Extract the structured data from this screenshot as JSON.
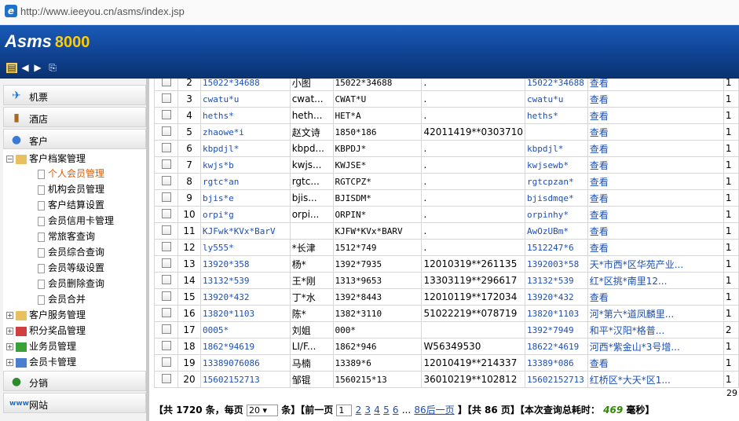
{
  "browser": {
    "url": "http://www.ieeyou.cn/asms/index.jsp"
  },
  "app": {
    "logo_text": "Asms",
    "logo_number": "8000"
  },
  "nav": {
    "ticket": "机票",
    "hotel": "酒店",
    "customer": "客户",
    "distribution": "分销",
    "website": "网站"
  },
  "tree": {
    "archive": "客户档案管理",
    "items": [
      "个人会员管理",
      "机构会员管理",
      "客户结算设置",
      "会员信用卡管理",
      "常旅客查询",
      "会员综合查询",
      "会员等级设置",
      "会员删除查询",
      "会员合并"
    ],
    "service": "客户服务管理",
    "points": "积分奖品管理",
    "staff": "业务员管理",
    "card": "会员卡管理"
  },
  "table": {
    "view_label": "查看",
    "rows": [
      {
        "no": "2",
        "c1": "15022*34688",
        "c2": "小图",
        "c3": "15022*34688",
        "c4": ".",
        "c5": "15022*34688",
        "c6": "查看",
        "c7": "1"
      },
      {
        "no": "3",
        "c1": "cwatu*u",
        "c2": "cwat...",
        "c3": "CWAT*U",
        "c4": ".",
        "c5": "cwatu*u",
        "c6": "查看",
        "c7": "1"
      },
      {
        "no": "4",
        "c1": "heths*",
        "c2": "heth...",
        "c3": "HET*A",
        "c4": ".",
        "c5": "heths*",
        "c6": "查看",
        "c7": "1"
      },
      {
        "no": "5",
        "c1": "zhaowe*i",
        "c2": "赵文诗",
        "c3": "1850*186",
        "c4": "42011419**0303710",
        "c5": "",
        "c6": "查看",
        "c7": "1"
      },
      {
        "no": "6",
        "c1": "kbpdjl*",
        "c2": "kbpd...",
        "c3": "KBPDJ*",
        "c4": ".",
        "c5": "kbpdjl*",
        "c6": "查看",
        "c7": "1"
      },
      {
        "no": "7",
        "c1": "kwjs*b",
        "c2": "kwjs...",
        "c3": "KWJSE*",
        "c4": ".",
        "c5": "kwjsewb*",
        "c6": "查看",
        "c7": "1"
      },
      {
        "no": "8",
        "c1": "rgtc*an",
        "c2": "rgtc...",
        "c3": "RGTCPZ*",
        "c4": ".",
        "c5": "rgtcpzan*",
        "c6": "查看",
        "c7": "1"
      },
      {
        "no": "9",
        "c1": "bjis*e",
        "c2": "bjis...",
        "c3": "BJISDM*",
        "c4": ".",
        "c5": "bjisdmqe*",
        "c6": "查看",
        "c7": "1"
      },
      {
        "no": "10",
        "c1": "orpi*g",
        "c2": "orpi...",
        "c3": "ORPIN*",
        "c4": ".",
        "c5": "orpinhy*",
        "c6": "查看",
        "c7": "1"
      },
      {
        "no": "11",
        "c1": "KJFwk*KVx*BarV",
        "c2": "",
        "c3": "KJFW*KVx*BARV",
        "c4": ".",
        "c5": "AwOzUBm*",
        "c6": "查看",
        "c7": "1"
      },
      {
        "no": "12",
        "c1": "ly555*",
        "c2": "*长津",
        "c3": "1512*749",
        "c4": ".",
        "c5": "1512247*6",
        "c6": "查看",
        "c7": "1"
      },
      {
        "no": "13",
        "c1": "13920*358",
        "c2": "杨*",
        "c3": "1392*7935",
        "c4": "12010319**261135",
        "c5": "1392003*58",
        "c6": "天*市西*区华苑产业...",
        "c7": "1"
      },
      {
        "no": "14",
        "c1": "13132*539",
        "c2": "王*刚",
        "c3": "1313*9653",
        "c4": "13303119**296617",
        "c5": "13132*539",
        "c6": "红*区挑*南里12...",
        "c7": "1"
      },
      {
        "no": "15",
        "c1": "13920*432",
        "c2": "丁*水",
        "c3": "1392*8443",
        "c4": "12010119**172034",
        "c5": "13920*432",
        "c6": "查看",
        "c7": "1"
      },
      {
        "no": "16",
        "c1": "13820*1103",
        "c2": "陈*",
        "c3": "1382*3110",
        "c4": "51022219**078719",
        "c5": "13820*1103",
        "c6": "河*第六*道凤麟里...",
        "c7": "1"
      },
      {
        "no": "17",
        "c1": "0005*",
        "c2": "刘姐",
        "c3": "000*",
        "c4": "",
        "c5": "1392*7949",
        "c6": "和平*汉阳*格普...",
        "c7": "2"
      },
      {
        "no": "18",
        "c1": "1862*94619",
        "c2": "LI/F...",
        "c3": "1862*946",
        "c4": "W56349530",
        "c5": "18622*4619",
        "c6": "河西*紫金山*3号增...",
        "c7": "1"
      },
      {
        "no": "19",
        "c1": "13389076086",
        "c2": "马楠",
        "c3": "13389*6",
        "c4": "12010419**214337",
        "c5": "13389*086",
        "c6": "查看",
        "c7": "1"
      },
      {
        "no": "20",
        "c1": "15602152713",
        "c2": "邹锟",
        "c3": "1560215*13",
        "c4": "36010219**102812",
        "c5": "15602152713",
        "c6": "红桥区*大天*区1...",
        "c7": "1"
      }
    ],
    "footer_tail": "29"
  },
  "pager": {
    "total_prefix": "【共",
    "total": "1720",
    "total_suffix": "条，每页",
    "per_page": "20",
    "per_suffix": "条】【前一页",
    "current_page": "1",
    "pages": [
      "2",
      "3",
      "4",
      "5",
      "6"
    ],
    "ellipsis": "...",
    "last_page_link": "86后一页",
    "pages_prefix": "】【共",
    "pages_total": "86",
    "pages_suffix": "页】【本次查询总耗时：",
    "elapsed": "469",
    "elapsed_suffix": "毫秒】"
  }
}
